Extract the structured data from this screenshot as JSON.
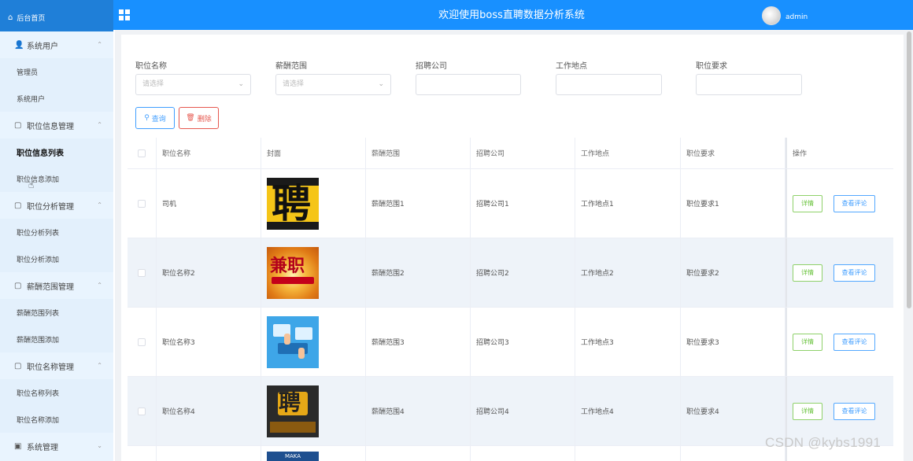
{
  "header": {
    "home_label": "后台首页",
    "title": "欢迎使用boss直聘数据分析系统",
    "username": "admin",
    "brand_color": "#1890ff"
  },
  "sidebar": {
    "groups": [
      {
        "label": "系统用户",
        "icon": "user-icon",
        "items": [
          "管理员",
          "系统用户"
        ]
      },
      {
        "label": "职位信息管理",
        "icon": "doc-icon",
        "items": [
          "职位信息列表",
          "职位信息添加"
        ]
      },
      {
        "label": "职位分析管理",
        "icon": "doc-icon",
        "items": [
          "职位分析列表",
          "职位分析添加"
        ]
      },
      {
        "label": "薪酬范围管理",
        "icon": "doc-icon",
        "items": [
          "薪酬范围列表",
          "薪酬范围添加"
        ]
      },
      {
        "label": "职位名称管理",
        "icon": "doc-icon",
        "items": [
          "职位名称列表",
          "职位名称添加"
        ]
      },
      {
        "label": "系统管理",
        "icon": "image-icon",
        "items": []
      }
    ],
    "active_item": "职位信息列表"
  },
  "filters": {
    "position_name": {
      "label": "职位名称",
      "placeholder": "请选择"
    },
    "salary_range": {
      "label": "薪酬范围",
      "placeholder": "请选择"
    },
    "company": {
      "label": "招聘公司",
      "value": ""
    },
    "location": {
      "label": "工作地点",
      "value": ""
    },
    "requirement": {
      "label": "职位要求",
      "value": ""
    }
  },
  "actions": {
    "query": "查询",
    "delete": "删除"
  },
  "table": {
    "headers": [
      "职位名称",
      "封面",
      "薪酬范围",
      "招聘公司",
      "工作地点",
      "职位要求",
      "操作"
    ],
    "rows": [
      {
        "name": "司机",
        "salary": "薪酬范围1",
        "company": "招聘公司1",
        "location": "工作地点1",
        "requirement": "职位要求1",
        "cover_text": "聘"
      },
      {
        "name": "职位名称2",
        "salary": "薪酬范围2",
        "company": "招聘公司2",
        "location": "工作地点2",
        "requirement": "职位要求2",
        "cover_text": "兼职"
      },
      {
        "name": "职位名称3",
        "salary": "薪酬范围3",
        "company": "招聘公司3",
        "location": "工作地点3",
        "requirement": "职位要求3",
        "cover_text": ""
      },
      {
        "name": "职位名称4",
        "salary": "薪酬范围4",
        "company": "招聘公司4",
        "location": "工作地点4",
        "requirement": "职位要求4",
        "cover_text": "聘"
      }
    ],
    "row_actions": {
      "detail": "详情",
      "review": "查看评论"
    },
    "partial_row_cover_text": "MAKA"
  },
  "watermark": "CSDN @kybs1991"
}
